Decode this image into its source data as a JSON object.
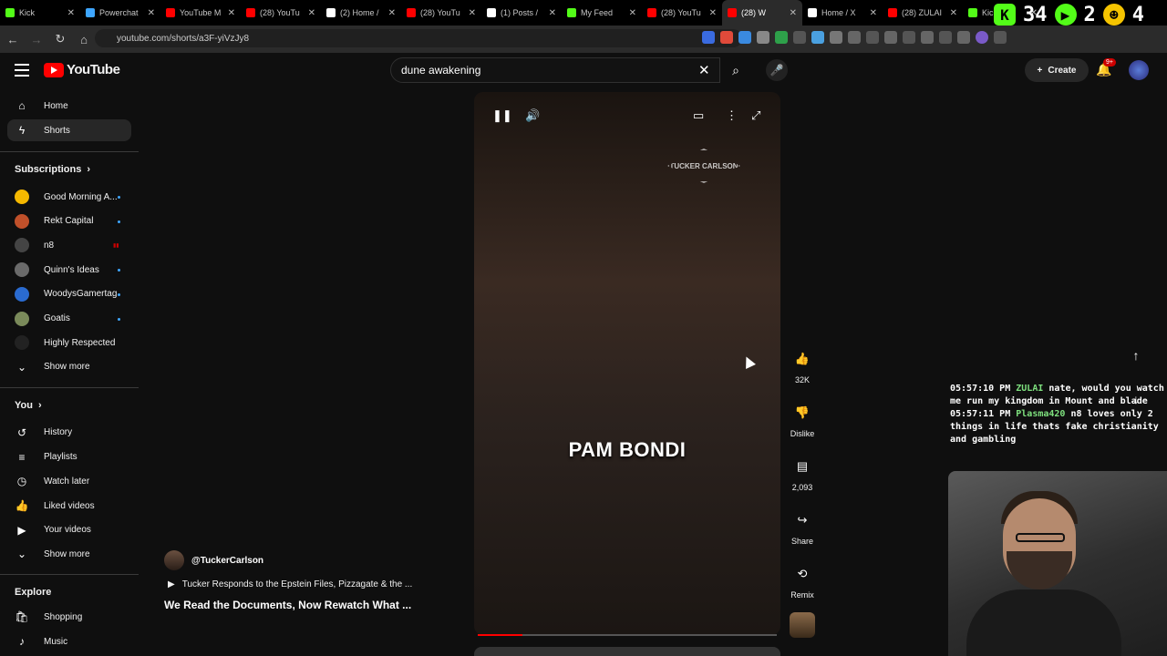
{
  "browser": {
    "tabs": [
      {
        "label": "Kick",
        "color": "#53fc18"
      },
      {
        "label": "Powerchat",
        "color": "#3ea6ff"
      },
      {
        "label": "YouTube M",
        "color": "#ff0000"
      },
      {
        "label": "(28) YouTu",
        "color": "#ff0000"
      },
      {
        "label": "(2) Home /",
        "color": "#ffffff"
      },
      {
        "label": "(28) YouTu",
        "color": "#ff0000"
      },
      {
        "label": "(1) Posts /",
        "color": "#ffffff"
      },
      {
        "label": "My Feed",
        "color": "#53fc18"
      },
      {
        "label": "(28) YouTu",
        "color": "#ff0000"
      },
      {
        "label": "(28) W",
        "color": "#ff0000",
        "active": true
      },
      {
        "label": "Home / X",
        "color": "#ffffff"
      },
      {
        "label": "(28) ZULAI",
        "color": "#ff0000"
      },
      {
        "label": "Kick",
        "color": "#53fc18"
      }
    ],
    "url": "youtube.com/shorts/a3F-yiVzJy8",
    "overlay_nums": [
      "34",
      "2",
      "4"
    ]
  },
  "header": {
    "brand": "YouTube",
    "search_value": "dune awakening",
    "create_label": "Create",
    "notif_count": "9+"
  },
  "sidebar": {
    "main": [
      {
        "label": "Home",
        "icon": "home-icon",
        "glyph": "⌂"
      },
      {
        "label": "Shorts",
        "icon": "shorts-icon",
        "glyph": "ϟ",
        "active": true
      }
    ],
    "subscriptions_heading": "Subscriptions",
    "subscriptions": [
      {
        "label": "Good Morning A...",
        "color": "#f5b800",
        "dot": true
      },
      {
        "label": "Rekt Capital",
        "color": "#c0502a",
        "dot": true
      },
      {
        "label": "n8",
        "color": "#444",
        "live": true
      },
      {
        "label": "Quinn's Ideas",
        "color": "#6a6a6a",
        "dot": true
      },
      {
        "label": "WoodysGamertag",
        "color": "#2a6bd0",
        "dot": true
      },
      {
        "label": "Goatis",
        "color": "#7a8a5a",
        "dot": true
      },
      {
        "label": "Highly Respected",
        "color": "#222",
        "dot": false
      }
    ],
    "show_more": "Show more",
    "you_heading": "You",
    "you": [
      {
        "label": "History",
        "icon": "history-icon",
        "glyph": "↺"
      },
      {
        "label": "Playlists",
        "icon": "playlists-icon",
        "glyph": "≡"
      },
      {
        "label": "Watch later",
        "icon": "watch-later-icon",
        "glyph": "◷"
      },
      {
        "label": "Liked videos",
        "icon": "thumb-up-icon",
        "glyph": "👍"
      },
      {
        "label": "Your videos",
        "icon": "your-videos-icon",
        "glyph": "▶"
      }
    ],
    "show_more_2": "Show more",
    "explore_heading": "Explore",
    "explore": [
      {
        "label": "Shopping",
        "icon": "shopping-icon",
        "glyph": "🛍"
      },
      {
        "label": "Music",
        "icon": "music-icon",
        "glyph": "♪"
      }
    ]
  },
  "short": {
    "caption": "PAM BONDI",
    "watermark": "TUCKER CARLSON",
    "channel": "@TuckerCarlson",
    "linked_video": "Tucker Responds to the Epstein Files, Pizzagate & the ...",
    "title": "We Read the Documents, Now Rewatch What ...",
    "progress": 0.15,
    "likes": "32K",
    "dislike_label": "Dislike",
    "comments": "2,093",
    "share_label": "Share",
    "remix_label": "Remix"
  },
  "chat": [
    {
      "time": "05:57:10 PM",
      "name": "ZULAI",
      "text": "nate, would you watch me run my kingdom in Mount and blade"
    },
    {
      "time": "05:57:11 PM",
      "name": "Plasma420",
      "text": "n8 loves only 2 things in life thats fake christianity and gambling"
    }
  ]
}
